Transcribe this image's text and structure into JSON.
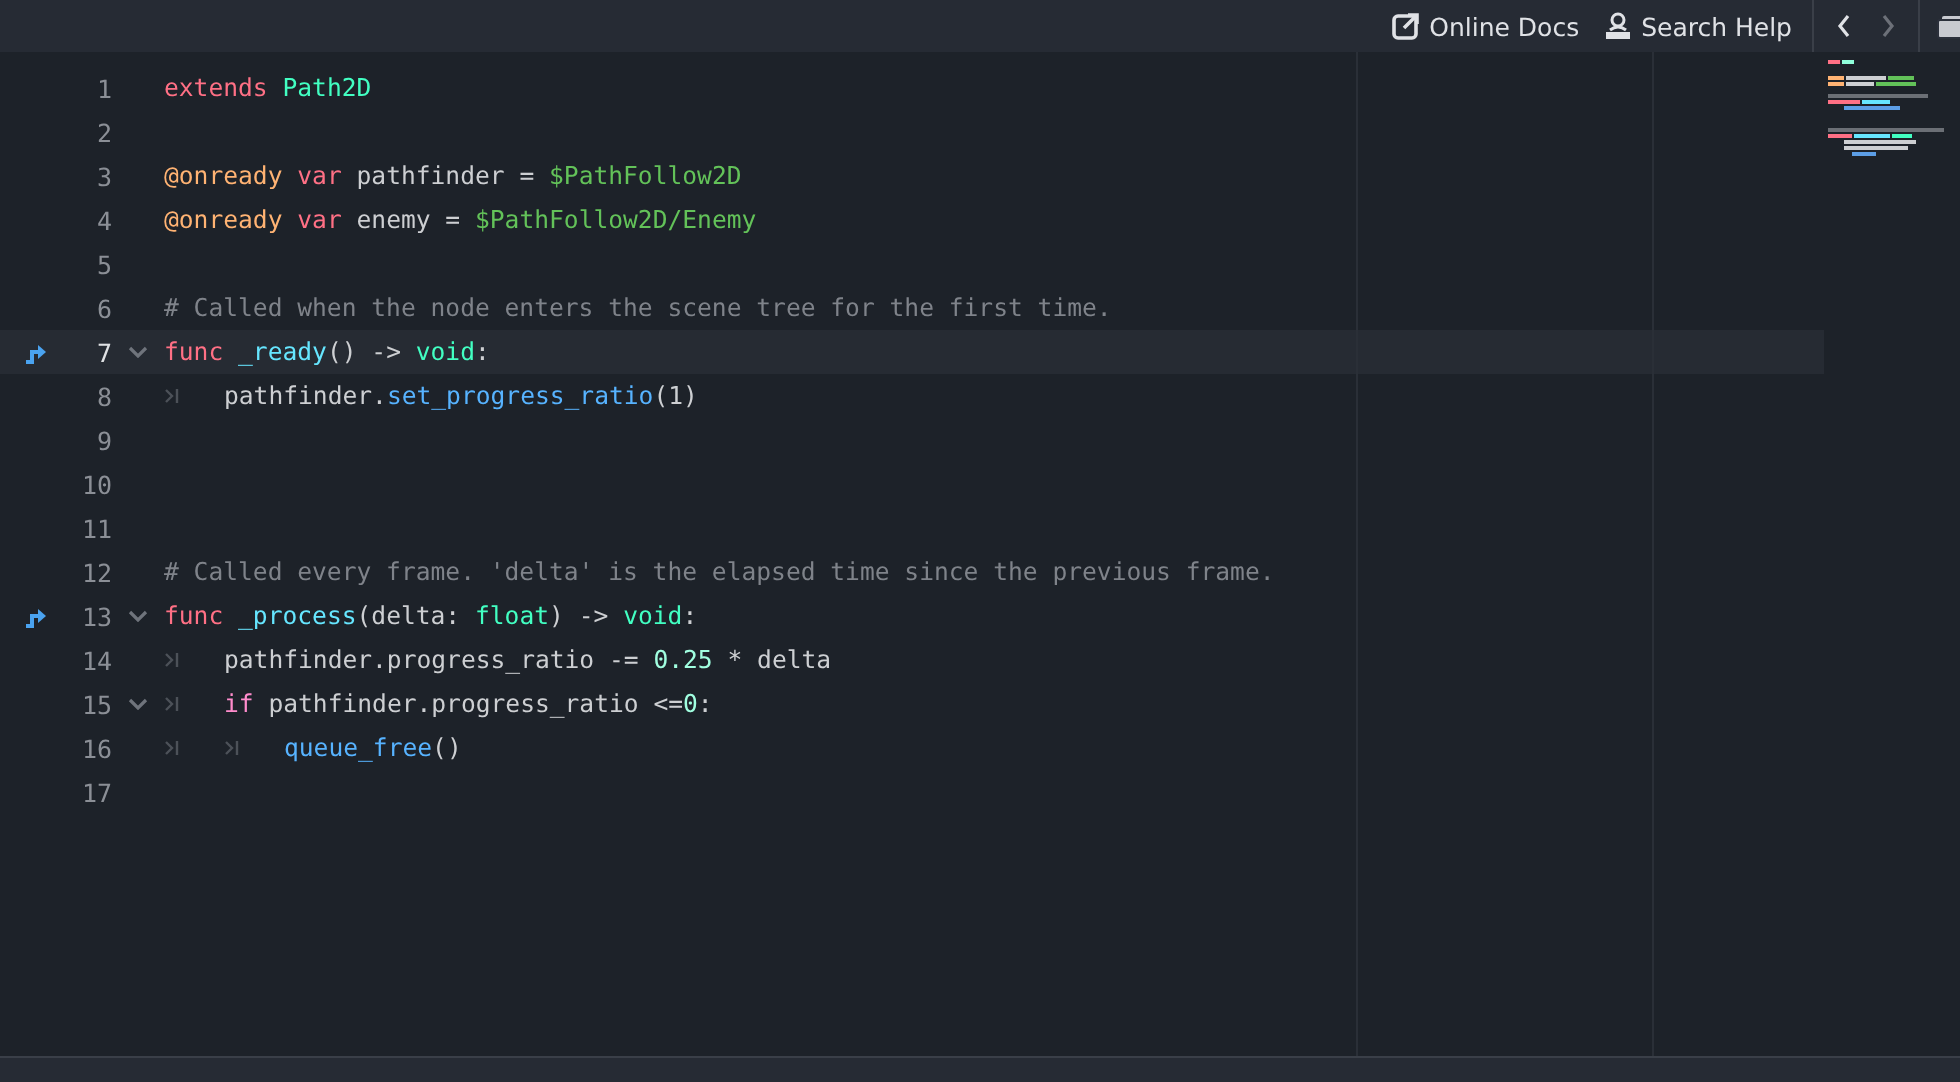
{
  "toolbar": {
    "links": [
      {
        "label": "Online Docs",
        "kind": "external"
      },
      {
        "label": "Search Help",
        "kind": "doc"
      }
    ],
    "nav": [
      {
        "kind": "back",
        "disabled": false
      },
      {
        "kind": "forward",
        "disabled": true
      }
    ]
  },
  "editor": {
    "lines": [
      {
        "number": "1",
        "tokens": [
          {
            "text": "extends ",
            "kind": "keyword"
          },
          {
            "text": "Path2D",
            "kind": "type"
          }
        ]
      },
      {
        "number": "2"
      },
      {
        "number": "3",
        "tokens": [
          {
            "text": "@onready ",
            "kind": "annotation"
          },
          {
            "text": "var",
            "kind": "keyword"
          },
          {
            "text": " pathfinder = ",
            "kind": "plain"
          },
          {
            "text": "$PathFollow2D",
            "kind": "nodepath"
          }
        ]
      },
      {
        "number": "4",
        "tokens": [
          {
            "text": "@onready ",
            "kind": "annotation"
          },
          {
            "text": "var",
            "kind": "keyword"
          },
          {
            "text": " enemy = ",
            "kind": "plain"
          },
          {
            "text": "$PathFollow2D/Enemy",
            "kind": "nodepath"
          }
        ]
      },
      {
        "number": "5"
      },
      {
        "number": "6",
        "tokens": [
          {
            "text": "# Called when the node enters the scene tree for the first time.",
            "kind": "comment"
          }
        ]
      },
      {
        "number": "7",
        "current": true,
        "override": true,
        "expanded": true,
        "tokens": [
          {
            "text": "func ",
            "kind": "keyword"
          },
          {
            "text": "_ready",
            "kind": "function"
          },
          {
            "text": "() -> ",
            "kind": "plain"
          },
          {
            "text": "void",
            "kind": "type"
          },
          {
            "text": ":",
            "kind": "plain"
          }
        ]
      },
      {
        "number": "8",
        "indent": [
          {
            "kind": "tab"
          }
        ],
        "tokens": [
          {
            "text": "pathfinder.",
            "kind": "plain"
          },
          {
            "text": "set_progress_ratio",
            "kind": "call"
          },
          {
            "text": "(1)",
            "kind": "plain"
          }
        ]
      },
      {
        "number": "9"
      },
      {
        "number": "10"
      },
      {
        "number": "11"
      },
      {
        "number": "12",
        "tokens": [
          {
            "text": "# Called every frame. 'delta' is the elapsed time since the previous frame.",
            "kind": "comment"
          }
        ]
      },
      {
        "number": "13",
        "override": true,
        "expanded": true,
        "tokens": [
          {
            "text": "func ",
            "kind": "keyword"
          },
          {
            "text": "_process",
            "kind": "function"
          },
          {
            "text": "(delta: ",
            "kind": "plain"
          },
          {
            "text": "float",
            "kind": "type"
          },
          {
            "text": ") -> ",
            "kind": "plain"
          },
          {
            "text": "void",
            "kind": "type"
          },
          {
            "text": ":",
            "kind": "plain"
          }
        ]
      },
      {
        "number": "14",
        "indent": [
          {
            "kind": "tab"
          }
        ],
        "tokens": [
          {
            "text": "pathfinder.progress_ratio -= ",
            "kind": "plain"
          },
          {
            "text": "0.25",
            "kind": "number"
          },
          {
            "text": " * delta",
            "kind": "plain"
          }
        ]
      },
      {
        "number": "15",
        "expanded": true,
        "indent": [
          {
            "kind": "tab"
          }
        ],
        "tokens": [
          {
            "text": "if",
            "kind": "control"
          },
          {
            "text": " pathfinder.progress_ratio <=",
            "kind": "plain"
          },
          {
            "text": "0",
            "kind": "number"
          },
          {
            "text": ":",
            "kind": "plain"
          }
        ]
      },
      {
        "number": "16",
        "indent": [
          {
            "kind": "tab"
          },
          {
            "kind": "tab"
          }
        ],
        "tokens": [
          {
            "text": "queue_free",
            "kind": "call"
          },
          {
            "text": "()",
            "kind": "plain"
          }
        ]
      },
      {
        "number": "17"
      }
    ]
  }
}
